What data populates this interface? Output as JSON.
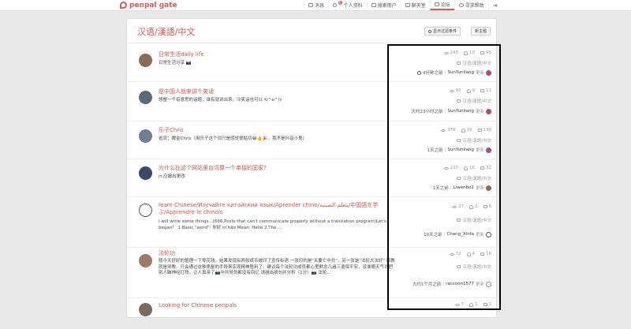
{
  "brand": {
    "name": "penpal gate",
    "color": "#e25555"
  },
  "nav": [
    {
      "label": "消息",
      "icon": "envelope-icon"
    },
    {
      "label": "个人资料",
      "icon": "person-icon",
      "badge": "6"
    },
    {
      "label": "搜索用户",
      "icon": "search-users-icon"
    },
    {
      "label": "聊天室",
      "icon": "chat-icon"
    },
    {
      "label": "论坛",
      "icon": "forum-icon",
      "active": true
    },
    {
      "label": "寻求帮助",
      "icon": "help-icon"
    }
  ],
  "signout_icon": "sign-out-icon",
  "forum": {
    "title": "汉语/漢語/中文",
    "filter_button": "显示过滤条件",
    "new_topic_button": "新主题"
  },
  "topics": [
    {
      "title": "日常生活daily life",
      "excerpt": "日常生活分享 📷",
      "views": "243",
      "participants": "10",
      "replies": "95",
      "category": "汉语/漢語/中文",
      "time": "4分钟之前",
      "user": "SunYunliang",
      "updated": "更新"
    },
    {
      "title": "是中国人就来讲个笑话",
      "excerpt": "想整一个有意思的话题，谁有就讲出来。冷笑话也可以 ٩(^o^)۶",
      "views": "93",
      "participants": "9",
      "replies": "11",
      "category": "汉语/漢語/中文",
      "time": "大约23小时之前",
      "user": "SunYunliang",
      "updated": "更新"
    },
    {
      "title": "乐子Chris",
      "excerpt": "省流：睥金Chris（用乐子这个词只是感觉很贴切😂👍🎉，我不是抖音小鬼)",
      "views": "378",
      "participants": "16",
      "replies": "139",
      "category": "汉语/漢語/中文",
      "time": "1天之前",
      "user": "SunYunliang",
      "updated": "更新"
    },
    {
      "title": "为什么在这个网站里台湾算一个单独的国家?",
      "excerpt": "rt,应撤出更改",
      "views": "233",
      "participants": "16",
      "replies": "32",
      "category": "汉语/漢語/中文",
      "time": "1天之前",
      "user": "Liwenbo1",
      "updated": "更新"
    },
    {
      "title": "learn Chinese/Изучайте китайский язык/Aprender chino/يتعلم الصينية/中国語を学ぶ/Apprendre le chinois",
      "excerpt": "I will write some things...(666,Posts that can't communicate properly without a translation program)Let's began！ 1.Basic \"word\": 你好 nǐ hǎo Mean: Hello 2.The ...",
      "views": "27",
      "participants": "2",
      "replies": "6",
      "category": "汉语/漢語/中文",
      "time": "10天之前",
      "user": "Chang_Xinfa",
      "updated": "更新"
    },
    {
      "title": "法轮功",
      "excerpt": "我今天好好的整理一下零花钱。结果发现有两张纸币被印了宣传标语 一张印的是\"天要亡中共\"，另一张是\"法轮大法好\" 邪教就是邪教。只会通过这种卑鄙的手段来实现精神胜利了。建议每个法轮功成员都心里默念几遍三退保平安，没准哪天气功把别人脑神经打残，让人真亲了📷中共党员都没有四亿 请拔出病句并分析（1分）📷 法轮...",
      "views": "72",
      "participants": "4",
      "replies": "18",
      "category": "汉语/漢語/中文",
      "time": "大约1个月之前",
      "user": "raccoon1577",
      "updated": "更新"
    },
    {
      "title": "Looking for Chinese penpals",
      "excerpt": "",
      "views": "7",
      "participants": "1",
      "replies": "1",
      "category": "",
      "time": "",
      "user": "",
      "updated": ""
    }
  ]
}
